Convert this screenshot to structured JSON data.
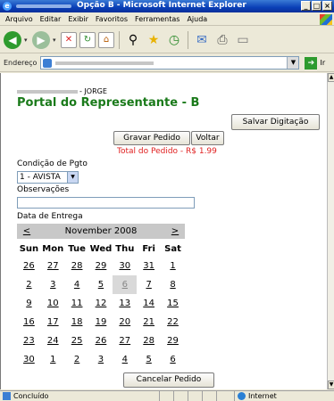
{
  "window": {
    "title": "Opção B - Microsoft Internet Explorer",
    "controls": {
      "minimize": "_",
      "maximize": "□",
      "close": "×"
    }
  },
  "menu": [
    "Arquivo",
    "Editar",
    "Exibir",
    "Favoritos",
    "Ferramentas",
    "Ajuda"
  ],
  "addressbar": {
    "label": "Endereço",
    "go_label": "Ir"
  },
  "page": {
    "user_suffix": "- JORGE",
    "title": "Portal do Representante - B",
    "save_button": "Salvar Digitação",
    "gravar_button": "Gravar Pedido",
    "voltar_button": "Voltar",
    "total_label": "Total do Pedido - R$ 1.99",
    "payment_label": "Condição de Pgto",
    "payment_selected": "1 - AVISTA",
    "notes_label": "Observações",
    "notes_value": "",
    "delivery_label": "Data de Entrega",
    "cancel_button": "Cancelar Pedido"
  },
  "calendar": {
    "prev": "<",
    "next": ">",
    "month": "November 2008",
    "weekdays": [
      "Sun",
      "Mon",
      "Tue",
      "Wed",
      "Thu",
      "Fri",
      "Sat"
    ],
    "weeks": [
      [
        "26",
        "27",
        "28",
        "29",
        "30",
        "31",
        "1"
      ],
      [
        "2",
        "3",
        "4",
        "5",
        "6",
        "7",
        "8"
      ],
      [
        "9",
        "10",
        "11",
        "12",
        "13",
        "14",
        "15"
      ],
      [
        "16",
        "17",
        "18",
        "19",
        "20",
        "21",
        "22"
      ],
      [
        "23",
        "24",
        "25",
        "26",
        "27",
        "28",
        "29"
      ],
      [
        "30",
        "1",
        "2",
        "3",
        "4",
        "5",
        "6"
      ]
    ],
    "highlighted": "6"
  },
  "status": {
    "text": "Concluído",
    "zone": "Internet"
  }
}
